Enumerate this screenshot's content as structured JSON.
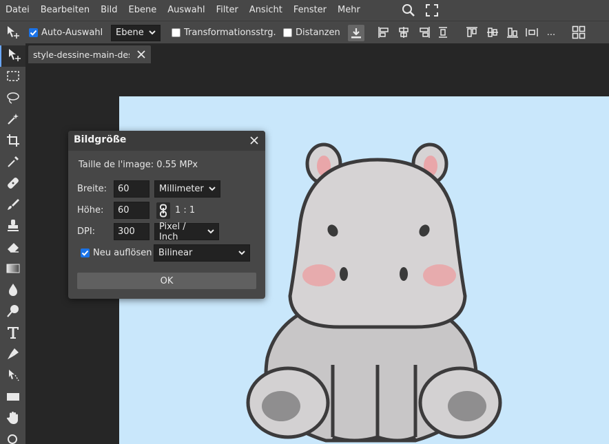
{
  "menu": {
    "items": [
      "Datei",
      "Bearbeiten",
      "Bild",
      "Ebene",
      "Auswahl",
      "Filter",
      "Ansicht",
      "Fenster",
      "Mehr"
    ],
    "icons": [
      "search-icon",
      "fullscreen-icon"
    ]
  },
  "options_bar": {
    "auto_select": {
      "label": "Auto-Auswahl",
      "checked": true
    },
    "layer_select": {
      "value": "Ebene"
    },
    "transform_controls": {
      "label": "Transformationsstrg.",
      "checked": false
    },
    "distances": {
      "label": "Distanzen",
      "checked": false
    },
    "more": "..."
  },
  "document_tab": {
    "title": "style-dessine-main-des"
  },
  "dialog": {
    "title": "Bildgröße",
    "image_size": "Taille de l'image: 0.55 MPx",
    "width": {
      "label": "Breite:",
      "value": "60",
      "unit": "Millimeter"
    },
    "height": {
      "label": "Höhe:",
      "value": "60",
      "ratio": "1 : 1"
    },
    "dpi": {
      "label": "DPI:",
      "value": "300",
      "unit": "Pixel / Inch"
    },
    "resample": {
      "label": "Neu auflösen",
      "checked": true,
      "method": "Bilinear"
    },
    "ok_label": "OK"
  },
  "colors": {
    "accent": "#1a73e8",
    "panel": "#474747",
    "background": "#262626",
    "canvas_bg": "#c9e7fb"
  }
}
